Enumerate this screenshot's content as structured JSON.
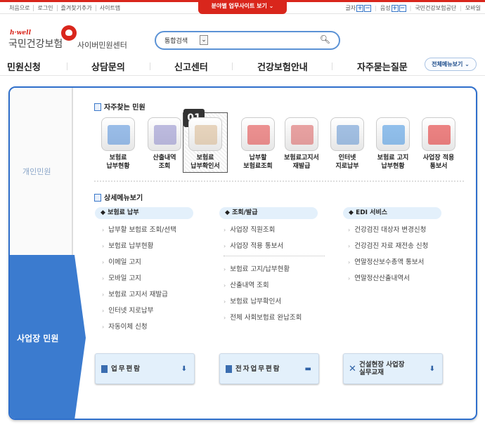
{
  "topbar": {
    "links": [
      "처음으로",
      "로그인",
      "즐겨찾기추가",
      "사이트맵"
    ],
    "center_tab": "분야별 업무사이트 보기",
    "font_label": "글자",
    "voice_label": "음성",
    "plus": "+",
    "minus": "−",
    "right_links": [
      "국민건강보험공단",
      "모바일"
    ]
  },
  "header": {
    "logo_small": "h·well",
    "brand": "국민건강보험",
    "subtitle": "사이버민원센터",
    "search": {
      "scope": "통합검색",
      "value": ""
    }
  },
  "gnb": {
    "items": [
      "민원신청",
      "상담문의",
      "신고센터",
      "건강보험안내",
      "자주묻는질문"
    ],
    "all_menu": "전체메뉴보기"
  },
  "side": {
    "personal": "개인민원",
    "business": "사업장 민원",
    "active": "business"
  },
  "favorites": {
    "title": "자주찾는 민원",
    "badge": "01",
    "items": [
      {
        "l1": "보험료",
        "l2": "납부현황",
        "color": "#4a8bd8"
      },
      {
        "l1": "산출내역",
        "l2": "조회",
        "color": "#8a86c8"
      },
      {
        "l1": "보험료",
        "l2": "납부확인서",
        "color": "#d7b58a"
      },
      {
        "l1": "납부할",
        "l2": "보험료조회",
        "color": "#e03a3a"
      },
      {
        "l1": "보험료고지서",
        "l2": "재발급",
        "color": "#d95a5a"
      },
      {
        "l1": "인터넷",
        "l2": "지로납부",
        "color": "#5b8fd0"
      },
      {
        "l1": "보험료 고지",
        "l2": "납부현황",
        "color": "#3c8fe0"
      },
      {
        "l1": "사업장 적용",
        "l2": "통보서",
        "color": "#e02020"
      }
    ]
  },
  "detail": {
    "title": "상세메뉴보기",
    "columns": [
      {
        "title": "보험료 납부",
        "items": [
          "납부할 보험료 조회/선택",
          "보험료 납부현황",
          "이메일 고지",
          "모바일 고지",
          "보험료 고지서 재발급",
          "인터넷 지로납부",
          "자동이체 신청"
        ]
      },
      {
        "title": "조회/발급",
        "items": [
          "사업장 직원조회",
          "사업장 적용 통보서"
        ],
        "items2": [
          "보험료 고지/납부현황",
          "산출내역 조회",
          "보험료 납부확인서",
          "전체 사회보험료 완납조회"
        ]
      },
      {
        "title": "EDI 서비스",
        "items": [
          "건강검진 대상자 변경신청",
          "건강검진 자료 재전송 신청",
          "연말정산보수총액 통보서",
          "연말정산산출내역서"
        ]
      }
    ]
  },
  "downloads": [
    {
      "l1": "업무편람",
      "l2": ""
    },
    {
      "l1": "전자업무편람",
      "l2": ""
    },
    {
      "l1": "건설현장 사업장",
      "l2": "실무교재"
    }
  ]
}
